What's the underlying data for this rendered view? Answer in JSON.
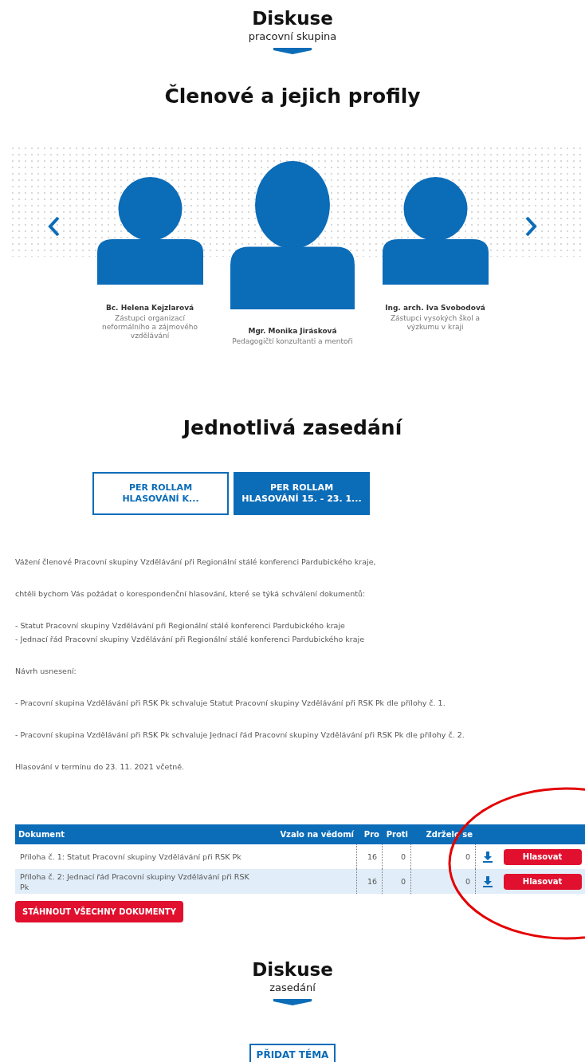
{
  "discussion_header": {
    "title": "Diskuse",
    "subtitle": "pracovní skupina"
  },
  "members_section": {
    "title": "Členové a jejich profily",
    "members": [
      {
        "name": "Bc. Helena Kejzlarová",
        "role": "Zástupci organizací neformálního a zájmového vzdělávání"
      },
      {
        "name": "Mgr. Monika Jirásková",
        "role": "Pedagogičtí konzultanti a mentoři"
      },
      {
        "name": "Ing. arch. Iva Svobodová",
        "role": "Zástupci vysokých škol a výzkumu v kraji"
      }
    ]
  },
  "meetings_section": {
    "title": "Jednotlivá zasedání",
    "tabs": [
      {
        "label": "PER ROLLAM HLASOVÁNÍ K...",
        "selected": false
      },
      {
        "label": "PER ROLLAM HLASOVÁNÍ 15. - 23. 1...",
        "selected": true
      }
    ],
    "message": [
      {
        "lines": [
          "Vážení členové Pracovní skupiny Vzdělávání při Regionální stálé konferenci Pardubického kraje,"
        ]
      },
      {
        "lines": [
          "chtěli bychom Vás požádat o korespondenční hlasování, které se týká schválení dokumentů:"
        ]
      },
      {
        "lines": [
          "- Statut Pracovní skupiny Vzdělávání při Regionální stálé konferenci Pardubického kraje",
          "- Jednací řád Pracovní skupiny Vzdělávání při Regionální stálé konferenci Pardubického kraje"
        ]
      },
      {
        "lines": [
          "Návrh usnesení:"
        ]
      },
      {
        "lines": [
          "- Pracovní skupina Vzdělávání při RSK Pk schvaluje Statut Pracovní skupiny Vzdělávání při RSK Pk dle přílohy č. 1."
        ]
      },
      {
        "lines": [
          "- Pracovní skupina Vzdělávání při RSK Pk schvaluje Jednací řád Pracovní skupiny Vzdělávání při RSK Pk dle přílohy č. 2."
        ]
      },
      {
        "lines": [
          "Hlasování v termínu do 23. 11. 2021 včetně."
        ]
      }
    ],
    "table": {
      "columns": [
        "Dokument",
        "Vzalo na vědomí",
        "Pro",
        "Proti",
        "Zdrželo se"
      ],
      "rows": [
        {
          "document": "Příloha č. 1: Statut Pracovní skupiny Vzdělávání při RSK Pk",
          "for": "16",
          "against": "0",
          "abstained": "0",
          "vote_button": "Hlasovat"
        },
        {
          "document": "Příloha č. 2: Jednací řád Pracovní skupiny Vzdělávání při RSK Pk",
          "for": "16",
          "against": "0",
          "abstained": "0",
          "vote_button": "Hlasovat"
        }
      ]
    },
    "download_all_button": "STÁHNOUT VŠECHNY DOKUMENTY"
  },
  "meeting_discussion": {
    "title": "Diskuse",
    "subtitle": "zasedání",
    "add_topic_button": "PŘIDAT TÉMA"
  }
}
